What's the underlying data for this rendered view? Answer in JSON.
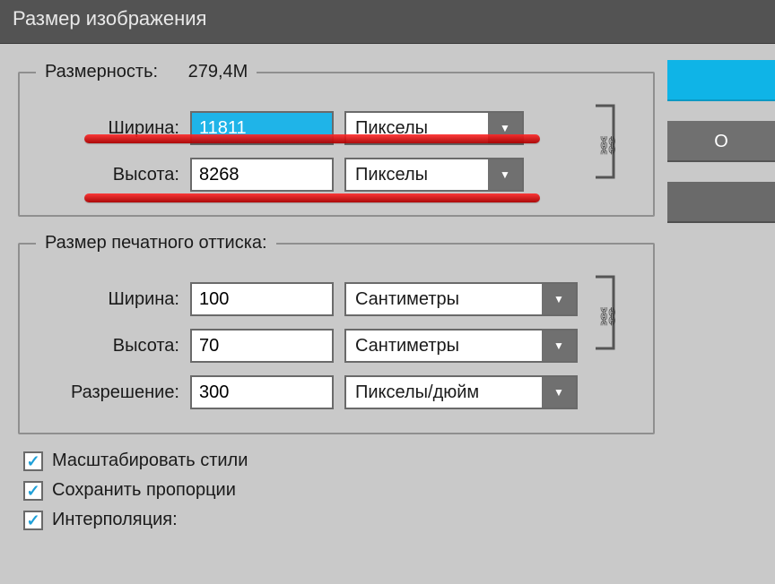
{
  "window": {
    "title": "Размер изображения"
  },
  "dimensions": {
    "legend": "Размерность:",
    "value": "279,4M",
    "width_label": "Ширина:",
    "width_value": "11811",
    "width_unit": "Пикселы",
    "height_label": "Высота:",
    "height_value": "8268",
    "height_unit": "Пикселы"
  },
  "print": {
    "legend": "Размер печатного оттиска:",
    "width_label": "Ширина:",
    "width_value": "100",
    "width_unit": "Сантиметры",
    "height_label": "Высота:",
    "height_value": "70",
    "height_unit": "Сантиметры",
    "res_label": "Разрешение:",
    "res_value": "300",
    "res_unit": "Пикселы/дюйм"
  },
  "checks": {
    "scale_styles": "Масштабировать стили",
    "constrain": "Сохранить пропорции",
    "interpolation": "Интерполяция:"
  },
  "buttons": {
    "ok": "",
    "cancel": "О",
    "auto": ""
  },
  "icons": {
    "chevron_down": "▼",
    "link": "⛓"
  }
}
